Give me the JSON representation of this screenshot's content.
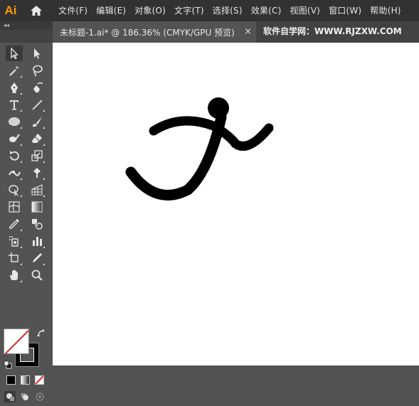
{
  "app": {
    "logo": "Ai"
  },
  "menu": [
    "文件(F)",
    "编辑(E)",
    "对象(O)",
    "文字(T)",
    "选择(S)",
    "效果(C)",
    "视图(V)",
    "窗口(W)",
    "帮助(H)"
  ],
  "panel": {
    "collapse_glyph": "◂◂"
  },
  "document_tab": {
    "title": "未标题-1.ai* @ 186.36% (CMYK/GPU 预览)",
    "close_glyph": "×"
  },
  "site_label": "软件自学网：WWW.RJZXW.COM",
  "tools": [
    "selection-tool",
    "direct-selection-tool",
    "magic-wand-tool",
    "lasso-tool",
    "pen-tool",
    "curvature-tool",
    "type-tool",
    "line-segment-tool",
    "ellipse-tool",
    "paintbrush-tool",
    "shaper-tool",
    "eraser-tool",
    "rotate-tool",
    "scale-tool",
    "width-tool",
    "puppet-warp-tool",
    "shape-builder-tool",
    "perspective-grid-tool",
    "mesh-tool",
    "gradient-tool",
    "eyedropper-tool",
    "blend-tool",
    "symbol-sprayer-tool",
    "column-graph-tool",
    "artboard-tool",
    "slice-tool",
    "hand-tool",
    "zoom-tool"
  ],
  "colors": {
    "menubar_bg": "#323232",
    "toolbar_bg": "#535353",
    "canvas_bg": "#ffffff",
    "logo_color": "#ff9a00",
    "stroke_color": "#000000",
    "none_slash": "#e02020"
  }
}
